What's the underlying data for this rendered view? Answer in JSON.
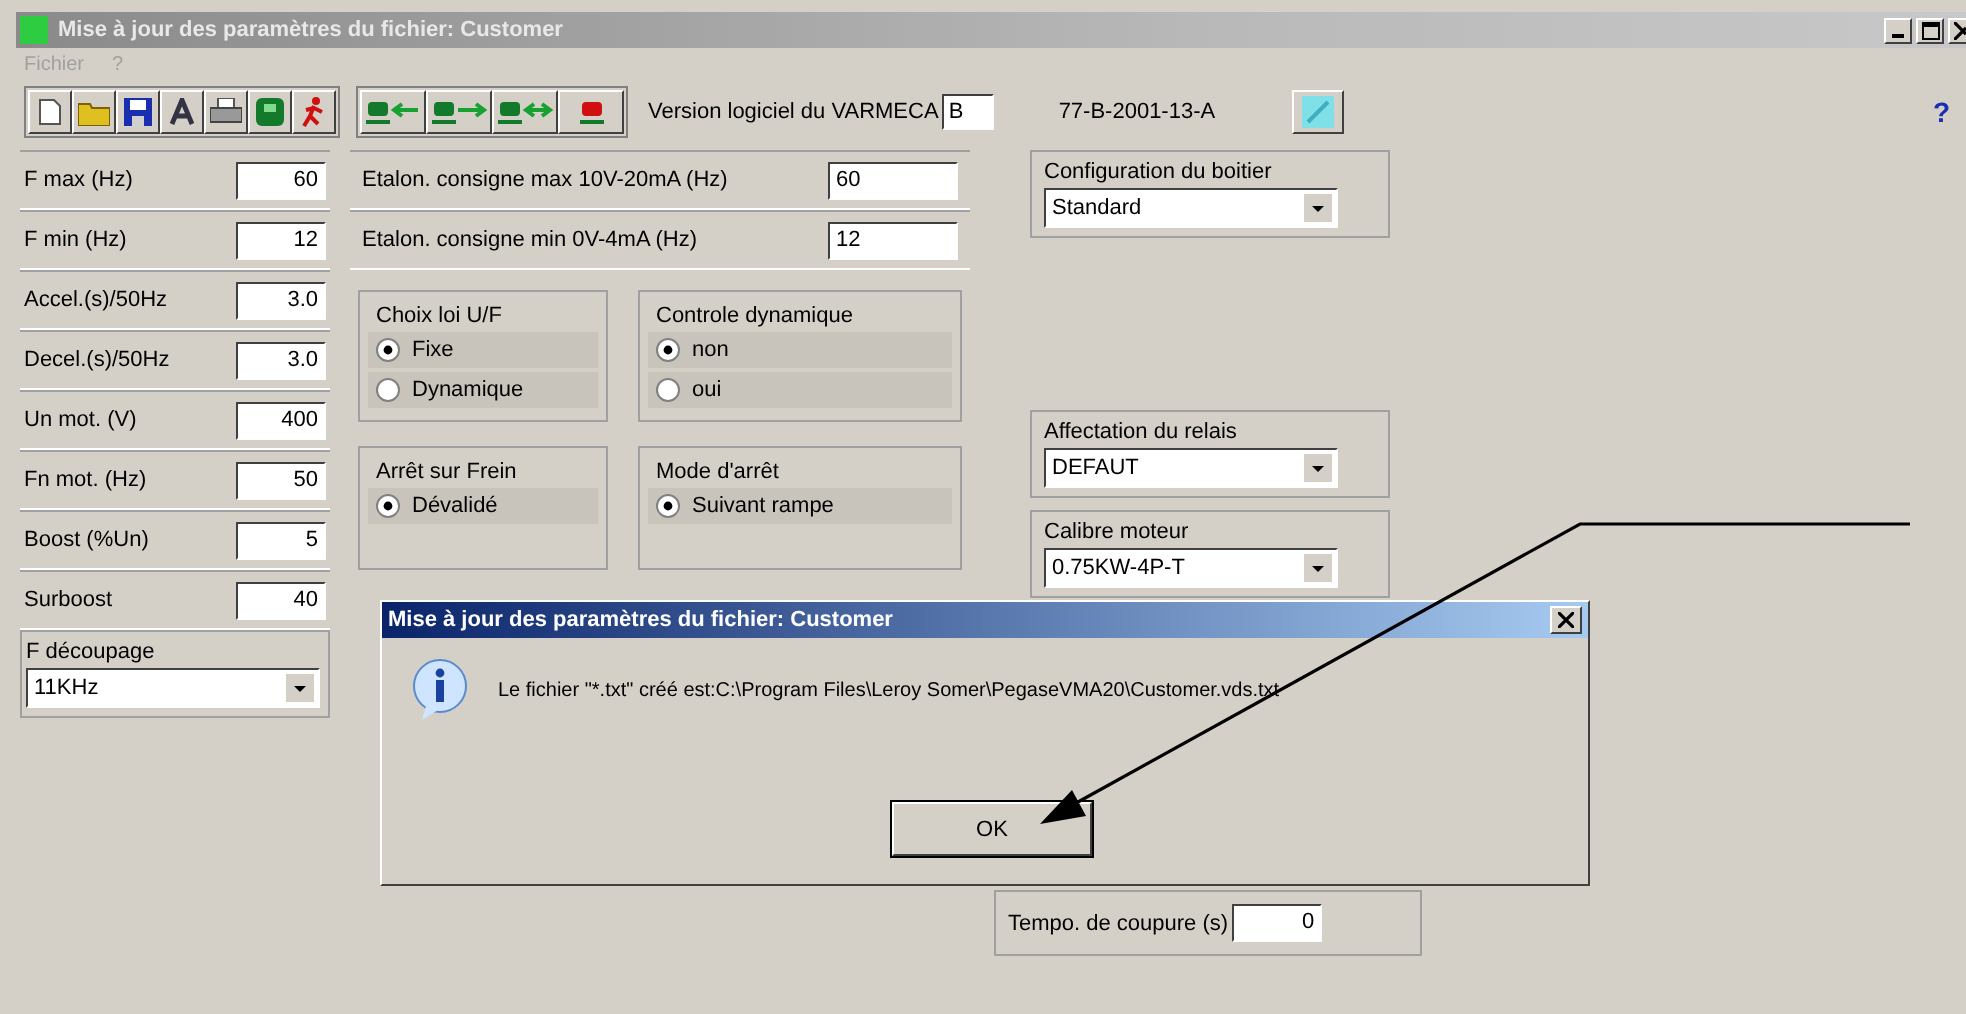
{
  "window": {
    "title": "Mise à jour des paramètres du fichier: Customer",
    "menu": [
      "Fichier",
      "?"
    ]
  },
  "version": {
    "label": "Version logiciel du VARMECA",
    "value": "B",
    "code": "77-B-2001-13-A"
  },
  "help": "?",
  "left_fields": [
    {
      "label": "F max (Hz)",
      "value": "60"
    },
    {
      "label": "F min (Hz)",
      "value": "12"
    },
    {
      "label": "Accel.(s)/50Hz",
      "value": "3.0"
    },
    {
      "label": "Decel.(s)/50Hz",
      "value": "3.0"
    },
    {
      "label": "Un mot. (V)",
      "value": "400"
    },
    {
      "label": "Fn mot. (Hz)",
      "value": "50"
    },
    {
      "label": "Boost (%Un)",
      "value": "5"
    },
    {
      "label": "Surboost",
      "value": "40"
    }
  ],
  "switching_frequency": {
    "label": "F découpage",
    "value": "11KHz"
  },
  "calibration_fields": [
    {
      "label": "Etalon. consigne max 10V-20mA (Hz)",
      "value": "60"
    },
    {
      "label": "Etalon. consigne min  0V-4mA (Hz)",
      "value": "12"
    }
  ],
  "radio_groups": [
    {
      "title": "Choix loi U/F",
      "options": [
        {
          "label": "Fixe",
          "selected": true
        },
        {
          "label": "Dynamique",
          "selected": false
        }
      ]
    },
    {
      "title": "Controle dynamique",
      "options": [
        {
          "label": "non",
          "selected": true
        },
        {
          "label": "oui",
          "selected": false
        }
      ]
    },
    {
      "title": "Arrêt sur Frein",
      "options": [
        {
          "label": "Dévalidé",
          "selected": true
        }
      ]
    },
    {
      "title": "Mode d'arrêt",
      "options": [
        {
          "label": "Suivant rampe",
          "selected": true
        }
      ]
    }
  ],
  "right_selects": [
    {
      "label": "Configuration du boitier",
      "value": "Standard"
    },
    {
      "label": "Affectation du relais",
      "value": "DEFAUT"
    },
    {
      "label": "Calibre moteur",
      "value": "0.75KW-4P-T"
    }
  ],
  "cutoff_delay": {
    "label": "Tempo. de coupure (s)",
    "value": "0"
  },
  "dialog": {
    "title": "Mise à jour des paramètres du fichier: Customer",
    "message": "Le fichier \"*.txt\" créé est:C:\\Program Files\\Leroy Somer\\PegaseVMA20\\Customer.vds.txt",
    "button": "OK"
  }
}
